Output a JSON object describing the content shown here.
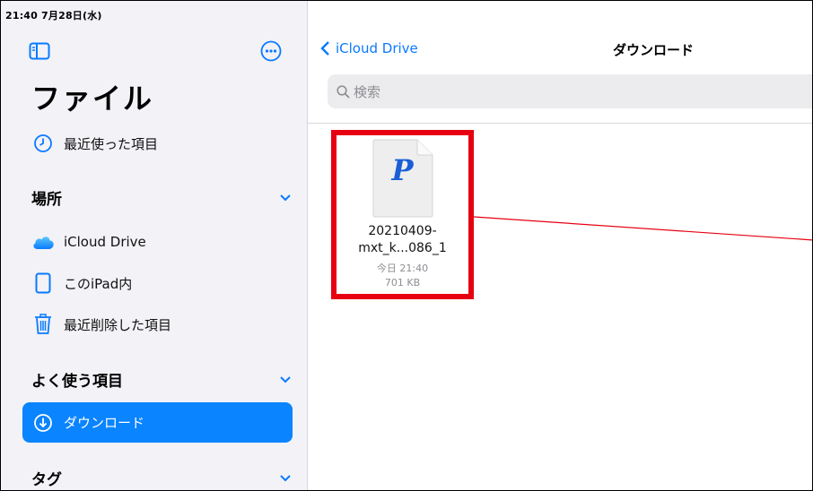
{
  "status_bar": {
    "time_date": "21:40  7月28日(水)"
  },
  "sidebar": {
    "title": "ファイル",
    "recents_label": "最近使った項目",
    "locations": {
      "title": "場所",
      "items": [
        {
          "label": "iCloud Drive",
          "icon": "icloud-icon"
        },
        {
          "label": "このiPad内",
          "icon": "ipad-icon"
        },
        {
          "label": "最近削除した項目",
          "icon": "trash-icon"
        }
      ]
    },
    "favorites": {
      "title": "よく使う項目",
      "items": [
        {
          "label": "ダウンロード",
          "icon": "download-icon",
          "selected": true
        }
      ]
    },
    "tags": {
      "title": "タグ"
    }
  },
  "main": {
    "back_label": "iCloud Drive",
    "title": "ダウンロード",
    "search_placeholder": "検索",
    "files": [
      {
        "icon_letter": "P",
        "name_line1": "20210409-",
        "name_line2": "mxt_k...086_1",
        "date": "今日 21:40",
        "size": "701 KB"
      }
    ]
  },
  "colors": {
    "accent": "#0a84ff",
    "highlight": "#e60012",
    "sidebar_bg": "#f2f2f7"
  }
}
